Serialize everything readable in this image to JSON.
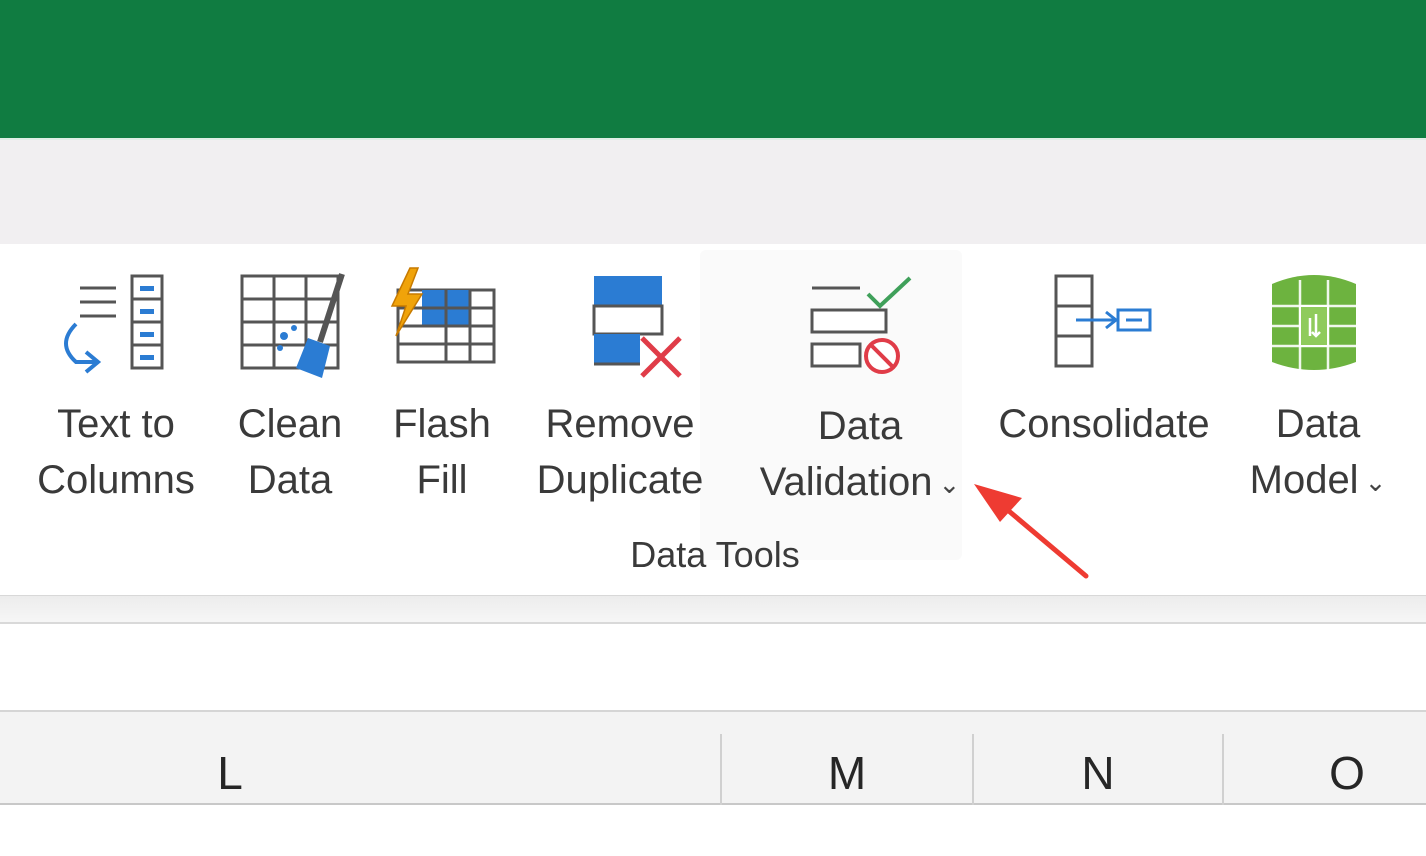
{
  "ribbon": {
    "buttons": {
      "text_to_columns": {
        "line1": "Text to",
        "line2": "Columns"
      },
      "clean_data": {
        "line1": "Clean",
        "line2": "Data"
      },
      "flash_fill": {
        "line1": "Flash",
        "line2": "Fill"
      },
      "remove_duplicate": {
        "line1": "Remove",
        "line2": "Duplicate"
      },
      "data_validation": {
        "line1": "Data",
        "line2": "Validation",
        "chevron": "⌄"
      },
      "consolidate": {
        "line1": "Consolidate"
      },
      "data_model": {
        "line1": "Data",
        "line2": "Model",
        "chevron": "⌄"
      }
    },
    "group_label": "Data Tools"
  },
  "columns": [
    "L",
    "M",
    "N",
    "O"
  ],
  "colors": {
    "title_bar": "#107c41",
    "accent_blue": "#2b7cd3",
    "flash_orange": "#f0a30a",
    "remove_red": "#e03c48",
    "model_green": "#6db33f",
    "arrow_red": "#ee3b32"
  },
  "icons": {
    "text_to_columns": "text-to-columns-icon",
    "clean_data": "clean-data-icon",
    "flash_fill": "flash-fill-icon",
    "remove_duplicate": "remove-duplicate-icon",
    "data_validation": "data-validation-icon",
    "consolidate": "consolidate-icon",
    "data_model": "data-model-icon"
  }
}
